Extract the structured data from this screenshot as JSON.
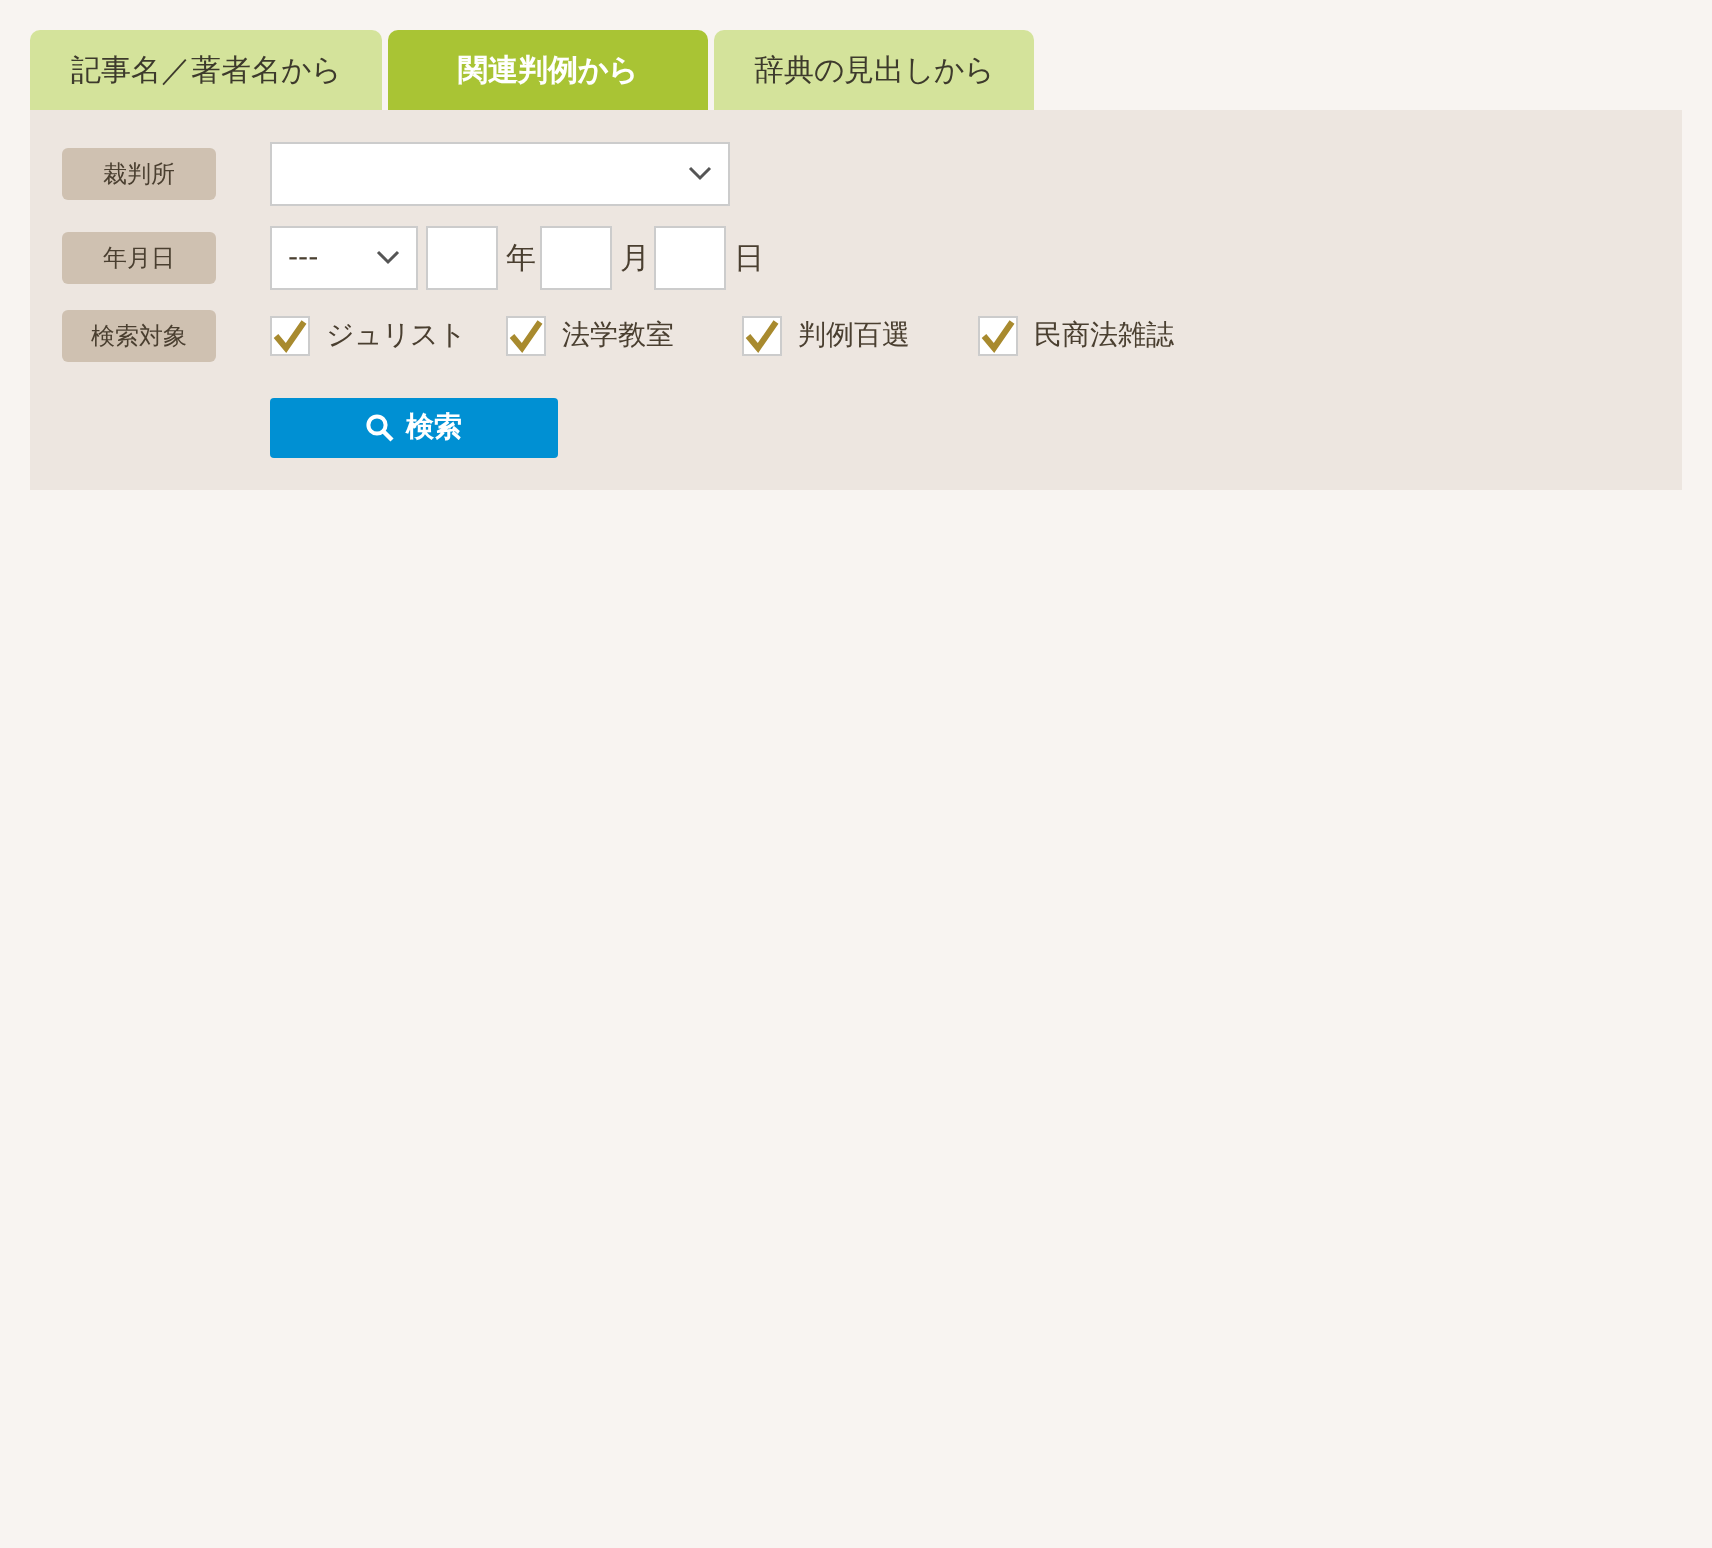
{
  "tabs": [
    {
      "label": "記事名／著者名から",
      "selected": false
    },
    {
      "label": "関連判例から",
      "selected": true
    },
    {
      "label": "辞典の見出しから",
      "selected": false
    }
  ],
  "court": {
    "label": "裁判所"
  },
  "date": {
    "label": "年月日",
    "era": "---",
    "units": [
      "年",
      "月",
      "日"
    ]
  },
  "targets": {
    "label": "検索対象",
    "options": [
      {
        "label": "ジュリスト",
        "checked": true
      },
      {
        "label": "法学教室",
        "checked": true
      },
      {
        "label": "判例百選",
        "checked": true
      },
      {
        "label": "民商法雑誌",
        "checked": true
      }
    ]
  },
  "search_button": {
    "label": "検索"
  }
}
